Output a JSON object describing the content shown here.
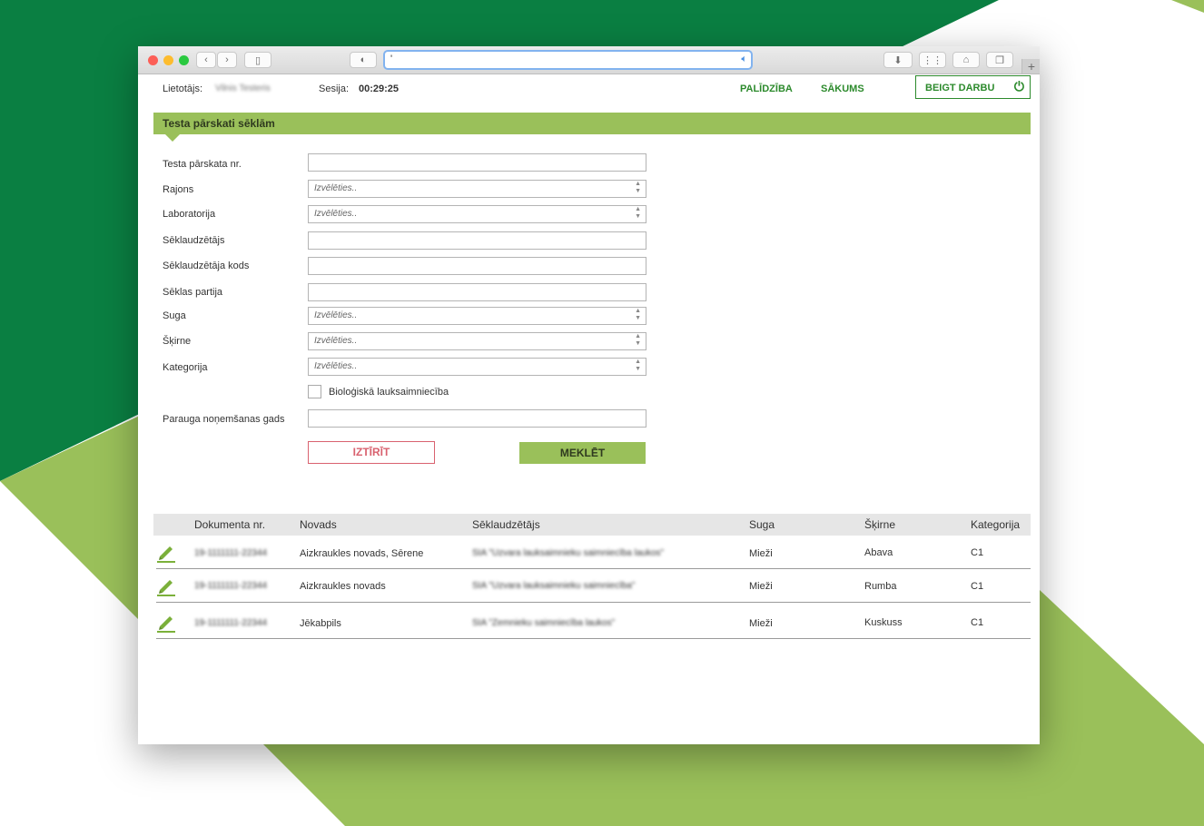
{
  "browser": {
    "url": "'"
  },
  "header": {
    "user_label": "Lietotājs:",
    "user_name": "Vilnis Testeris",
    "session_label": "Sesija:",
    "session_time": "00:29:25",
    "help_link": "PALĪDZĪBA",
    "home_link": "SĀKUMS",
    "logout_button": "BEIGT DARBU"
  },
  "section": {
    "title": "Testa pārskati sēklām"
  },
  "form": {
    "report_nr_label": "Testa pārskata nr.",
    "district_label": "Rajons",
    "laboratory_label": "Laboratorija",
    "seed_producer_label": "Sēklaudzētājs",
    "seed_producer_code_label": "Sēklaudzētāja kods",
    "seed_lot_label": "Sēklas partija",
    "species_label": "Suga",
    "variety_label": "Šķirne",
    "category_label": "Kategorija",
    "organic_label": "Bioloģiskā lauksaimniecība",
    "sampling_year_label": "Parauga noņemšanas gads",
    "select_placeholder": "Izvēlēties..",
    "clear_button": "IZTĪRĪT",
    "search_button": "MEKLĒT"
  },
  "table": {
    "columns": [
      "Dokumenta nr.",
      "Novads",
      "Sēklaudzētājs",
      "Suga",
      "Šķirne",
      "Kategorija"
    ],
    "rows": [
      {
        "doc": "19-1111111-22344",
        "region": "Aizkraukles novads, Sērene",
        "producer": "SIA \"Uzvara lauksaimnieku saimniecība laukos\"",
        "species": "Mieži",
        "variety": "Abava",
        "category": "C1"
      },
      {
        "doc": "19-1111111-22344",
        "region": "Aizkraukles novads",
        "producer": "SIA \"Uzvara lauksaimnieku saimniecība\"",
        "species": "Mieži",
        "variety": "Rumba",
        "category": "C1"
      },
      {
        "doc": "19-1111111-22344",
        "region": "Jēkabpils",
        "producer": "SIA \"Zemnieku saimniecība laukos\"",
        "species": "Mieži",
        "variety": "Kuskuss",
        "category": "C1"
      }
    ]
  },
  "icons": {
    "edit": "pencil-icon",
    "power": "power-icon"
  },
  "colors": {
    "accent_green": "#9ac05a",
    "link_green": "#2c8a2c",
    "dark_green_bg": "#0a7f42",
    "clear_red": "#d9626f"
  }
}
